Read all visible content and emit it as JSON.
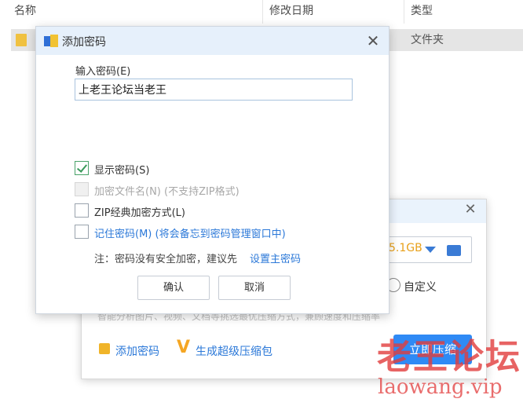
{
  "explorer": {
    "columns": [
      "名称",
      "修改日期",
      "类型"
    ],
    "row": {
      "type": "文件夹"
    }
  },
  "compress_dialog": {
    "size_value": "5.1GB",
    "custom_option": "自定义",
    "description": "智能分析图片、视频、文档等挑选最优压缩方式，兼顾速度和压缩率",
    "add_password": "添加密码",
    "super_package": "生成超级压缩包",
    "start_button": "立即压缩"
  },
  "password_dialog": {
    "title": "添加密码",
    "input_label": "输入密码(E)",
    "input_value": "上老王论坛当老王",
    "options": [
      {
        "label": "显示密码(S)",
        "checked": true,
        "disabled": false,
        "link": false
      },
      {
        "label": "加密文件名(N) (不支持ZIP格式)",
        "checked": false,
        "disabled": true,
        "link": false
      },
      {
        "label": "ZIP经典加密方式(L)",
        "checked": false,
        "disabled": false,
        "link": false
      },
      {
        "label": "记住密码(M) (将会备忘到密码管理窗口中)",
        "checked": false,
        "disabled": false,
        "link": true
      }
    ],
    "note": "注：密码没有安全加密，建议先",
    "note_link": "设置主密码",
    "confirm": "确认",
    "cancel": "取消"
  },
  "watermark": {
    "cn": "老王论坛",
    "url": "laowang.vip"
  },
  "colors": {
    "accent": "#2b78d8",
    "titlebar": "#e6f0fb",
    "primary_button": "#2f8af5",
    "watermark": "#e13c3c"
  }
}
